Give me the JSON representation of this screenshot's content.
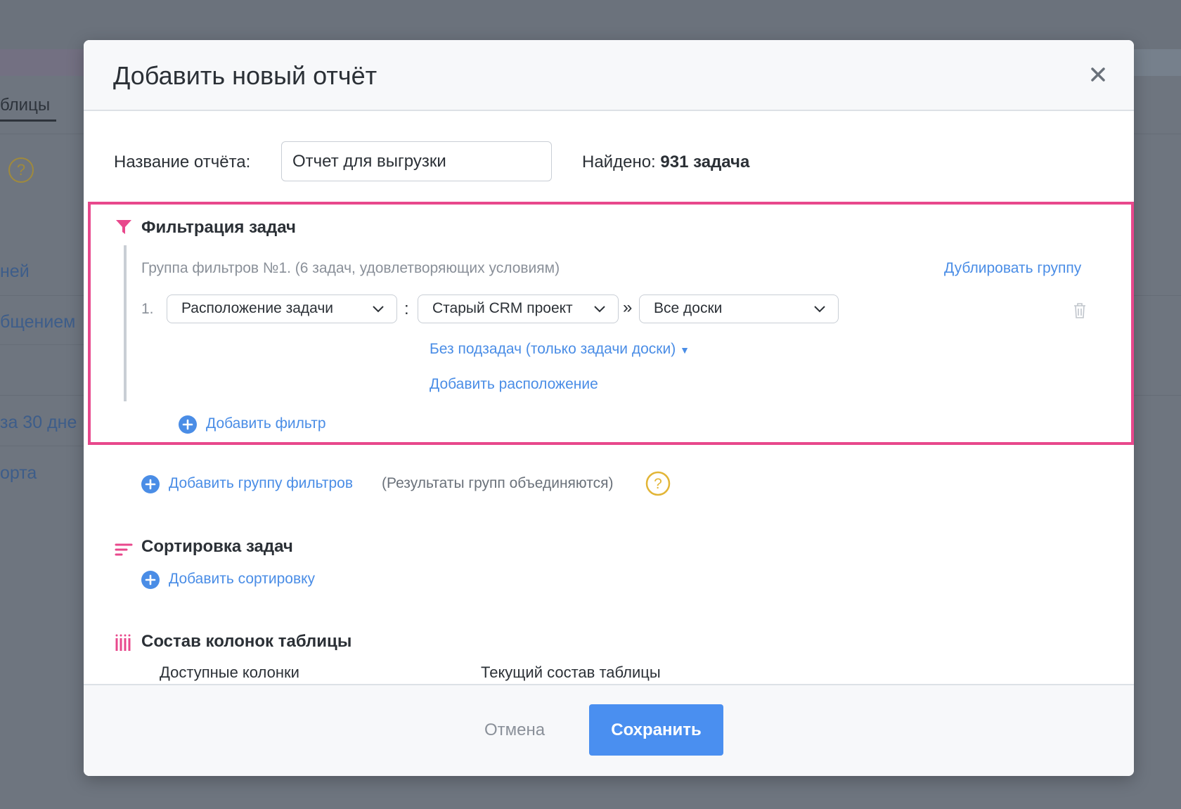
{
  "background": {
    "tab_label": "блицы",
    "items": [
      "ней",
      "бщением",
      "за 30 дне",
      "орта"
    ],
    "help_icon_glyph": "?"
  },
  "modal": {
    "title": "Добавить новый отчёт",
    "close_icon": "close-icon",
    "name_label": "Название отчёта:",
    "name_value": "Отчет для выгрузки",
    "found_prefix": "Найдено:",
    "found_value": "931 задача",
    "filter": {
      "title": "Фильтрация задач",
      "group_title": "Группа фильтров №1. (6 задач, удовлетворяющих условиям)",
      "duplicate_link": "Дублировать группу",
      "row_number": "1.",
      "field_select": "Расположение задачи",
      "separator_colon": ":",
      "project_select": "Старый CRM проект",
      "separator_arrow": "»",
      "board_select": "Все доски",
      "subtasks_link": "Без подзадач (только задачи доски)",
      "subtasks_caret": "▼",
      "add_location_link": "Добавить расположение",
      "add_filter_link": "Добавить фильтр"
    },
    "add_group_link": "Добавить группу фильтров",
    "add_group_note": "(Результаты групп объединяются)",
    "help_glyph": "?",
    "sorting": {
      "title": "Сортировка задач",
      "add_link": "Добавить сортировку"
    },
    "columns": {
      "title": "Состав колонок таблицы",
      "available_label": "Доступные колонки",
      "current_label": "Текущий состав таблицы"
    },
    "footer": {
      "cancel_label": "Отмена",
      "save_label": "Сохранить"
    }
  },
  "colors": {
    "accent": "#e8488c",
    "link": "#4a8de6",
    "primary_button": "#4a8ff0",
    "help": "#e2b536"
  }
}
